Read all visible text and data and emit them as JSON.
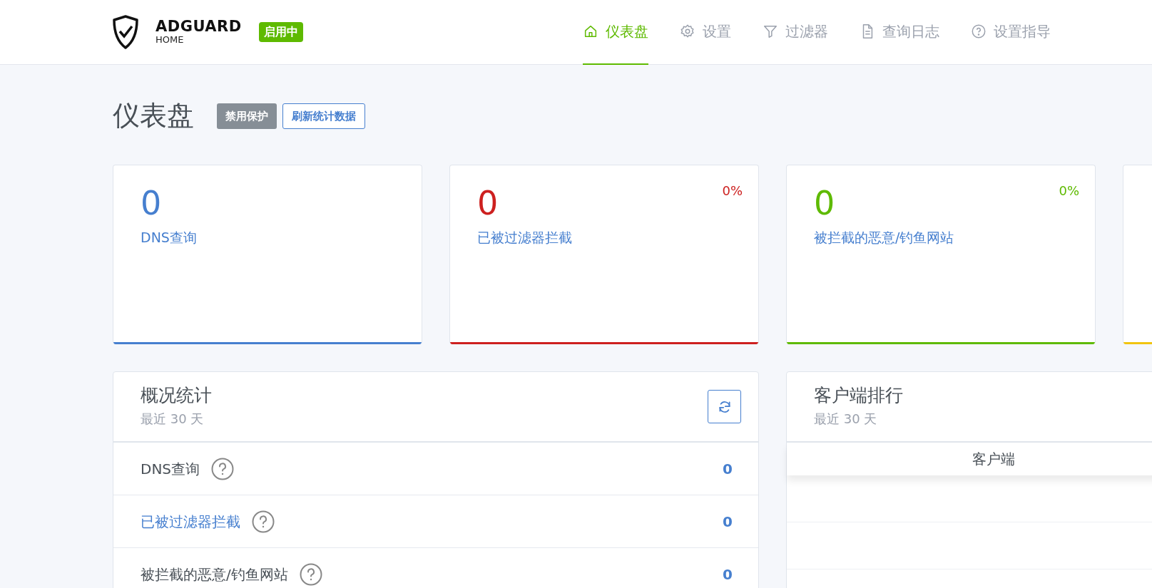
{
  "header": {
    "logo": {
      "title": "ADGUARD",
      "subtitle": "HOME"
    },
    "status_badge": "启用中",
    "nav": [
      {
        "label": "仪表盘",
        "kind": "home",
        "selected": true
      },
      {
        "label": "设置",
        "kind": "settings",
        "selected": false
      },
      {
        "label": "过滤器",
        "kind": "filters",
        "selected": false
      },
      {
        "label": "查询日志",
        "kind": "log",
        "selected": false
      },
      {
        "label": "设置指导",
        "kind": "guide",
        "selected": false
      }
    ]
  },
  "page_title": "仪表盘",
  "buttons": [
    {
      "label": "禁用保护",
      "kind": "secondary"
    },
    {
      "label": "刷新统计数据",
      "kind": "outline"
    }
  ],
  "stat_cards": [
    {
      "value": "0",
      "label": "DNS查询",
      "color": "#467fcf"
    },
    {
      "value": "0",
      "label": "已被过滤器拦截",
      "percent": "0%",
      "color": "#cd201f"
    },
    {
      "value": "0",
      "label": "被拦截的恶意/钓鱼网站",
      "percent": "0%",
      "color": "#5eba00"
    },
    {
      "color": "#f1c40f"
    }
  ],
  "general_stats": {
    "title": "概况统计",
    "subtitle": "最近 30 天",
    "rows": [
      {
        "label": "DNS查询",
        "value": "0",
        "link": false
      },
      {
        "label": "已被过滤器拦截",
        "value": "0",
        "link": true
      },
      {
        "label": "被拦截的恶意/钓鱼网站",
        "value": "0",
        "link": false
      }
    ]
  },
  "top_clients": {
    "title": "客户端排行",
    "subtitle": "最近 30 天",
    "columns": [
      "客户端"
    ]
  }
}
